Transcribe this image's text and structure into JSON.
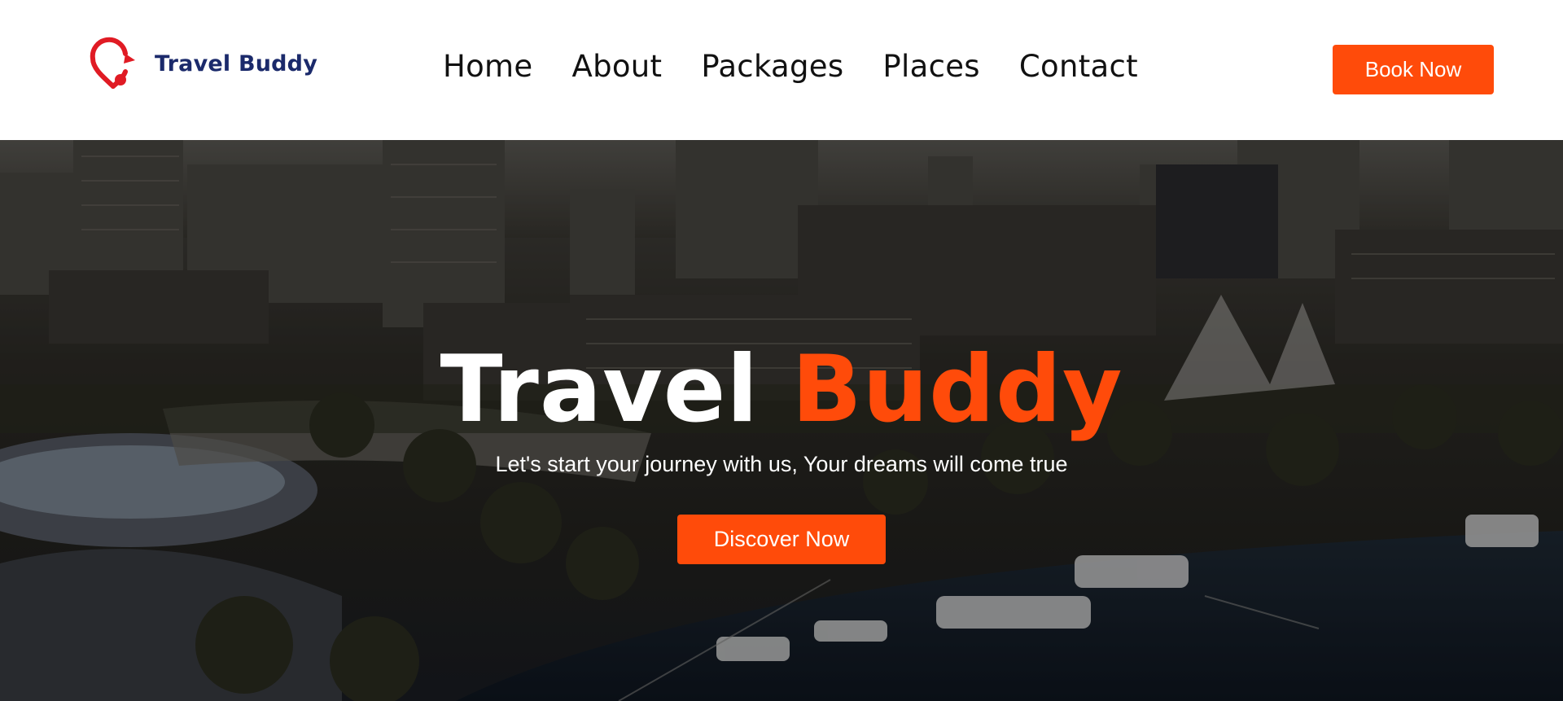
{
  "brand": {
    "name": "Travel Buddy",
    "icon": "map-pin-logo-icon",
    "color": "#1b2a6b",
    "accent": "#e01b24"
  },
  "nav": {
    "links": [
      {
        "label": "Home"
      },
      {
        "label": "About"
      },
      {
        "label": "Packages"
      },
      {
        "label": "Places"
      },
      {
        "label": "Contact"
      }
    ],
    "cta_label": "Book Now"
  },
  "hero": {
    "title_white": "Travel",
    "title_accent": "Buddy",
    "subtitle": "Let's start your journey with us, Your dreams will come true",
    "cta_label": "Discover Now",
    "background": "aerial-city-harbor-photo"
  },
  "colors": {
    "accent": "#ff4b0a",
    "text_dark": "#111111",
    "brand_navy": "#1b2a6b"
  }
}
